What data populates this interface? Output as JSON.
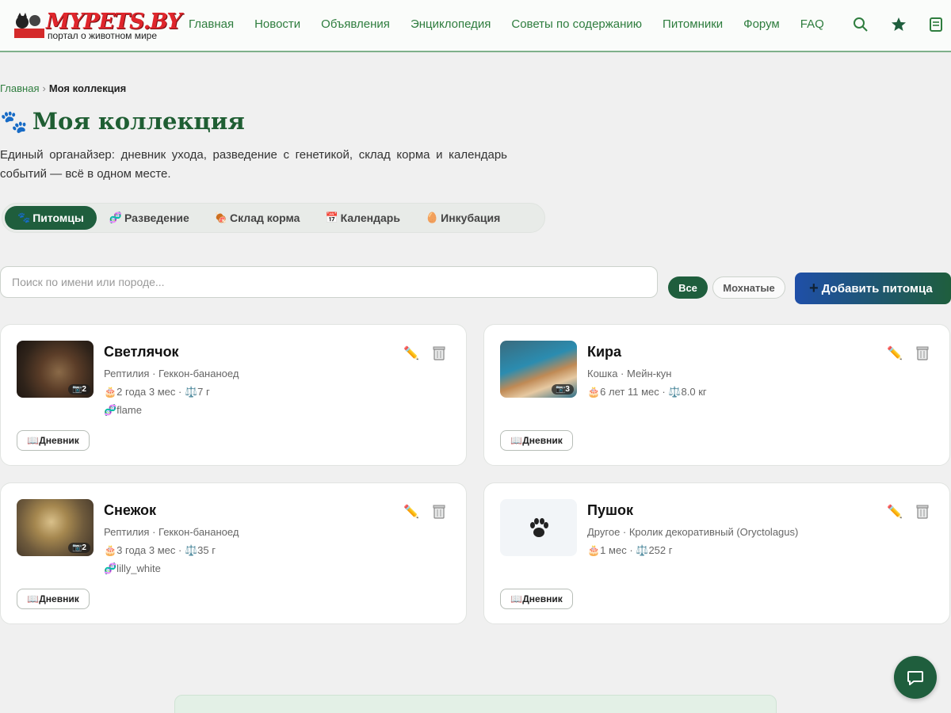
{
  "header": {
    "logo_text": "MYPETS.BY",
    "logo_subtitle": "портал о животном мире",
    "nav": [
      "Главная",
      "Новости",
      "Объявления",
      "Энциклопедия",
      "Советы по содержанию",
      "Питомники",
      "Форум",
      "FAQ"
    ],
    "icons": [
      "search-icon",
      "star-icon",
      "notes-icon"
    ],
    "accent_color": "#2e7d3e"
  },
  "breadcrumb": {
    "home": "Главная",
    "separator": "›",
    "current": "Моя коллекция"
  },
  "page": {
    "title_icon": "🐾",
    "title": "Моя коллекция",
    "lead": "Единый органайзер: дневник ухода, разведение с генетикой, склад корма и календарь событий — всё в одном месте."
  },
  "tabs": [
    {
      "icon": "🐾",
      "label": "Питомцы",
      "active": true
    },
    {
      "icon": "🧬",
      "label": "Разведение",
      "active": false
    },
    {
      "icon": "🍖",
      "label": "Склад корма",
      "active": false
    },
    {
      "icon": "📅",
      "label": "Календарь",
      "active": false
    },
    {
      "icon": "🥚",
      "label": "Инкубация",
      "active": false
    }
  ],
  "search": {
    "placeholder": "Поиск по имени или породе..."
  },
  "filters": {
    "all": "Все",
    "furry": "Мохнатые"
  },
  "add_button": {
    "icon": "+",
    "label": "Добавить питомца"
  },
  "pets": [
    {
      "name": "Светлячок",
      "species": "Рептилия · Геккон-бананоед",
      "age": "🎂2 года 3 мес",
      "weight": "⚖️7 г",
      "morph": "🧬flame",
      "photo_count": "📷2",
      "diary": "📖Дневник",
      "edit": "✏️"
    },
    {
      "name": "Кира",
      "species": "Кошка · Мейн-кун",
      "age": "🎂6 лет 11 мес",
      "weight": "⚖️8.0 кг",
      "morph": "",
      "photo_count": "📷3",
      "diary": "📖Дневник",
      "edit": "✏️"
    },
    {
      "name": "Снежок",
      "species": "Рептилия · Геккон-бананоед",
      "age": "🎂3 года 3 мес",
      "weight": "⚖️35 г",
      "morph": "🧬lilly_white",
      "photo_count": "📷2",
      "diary": "📖Дневник",
      "edit": "✏️"
    },
    {
      "name": "Пушок",
      "species": "Другое · Кролик декоративный (Oryctolagus)",
      "age": "🎂1 мес",
      "weight": "⚖️252 г",
      "morph": "",
      "photo_count": "",
      "diary": "📖Дневник",
      "edit": "✏️"
    }
  ],
  "meta_separator": " · "
}
